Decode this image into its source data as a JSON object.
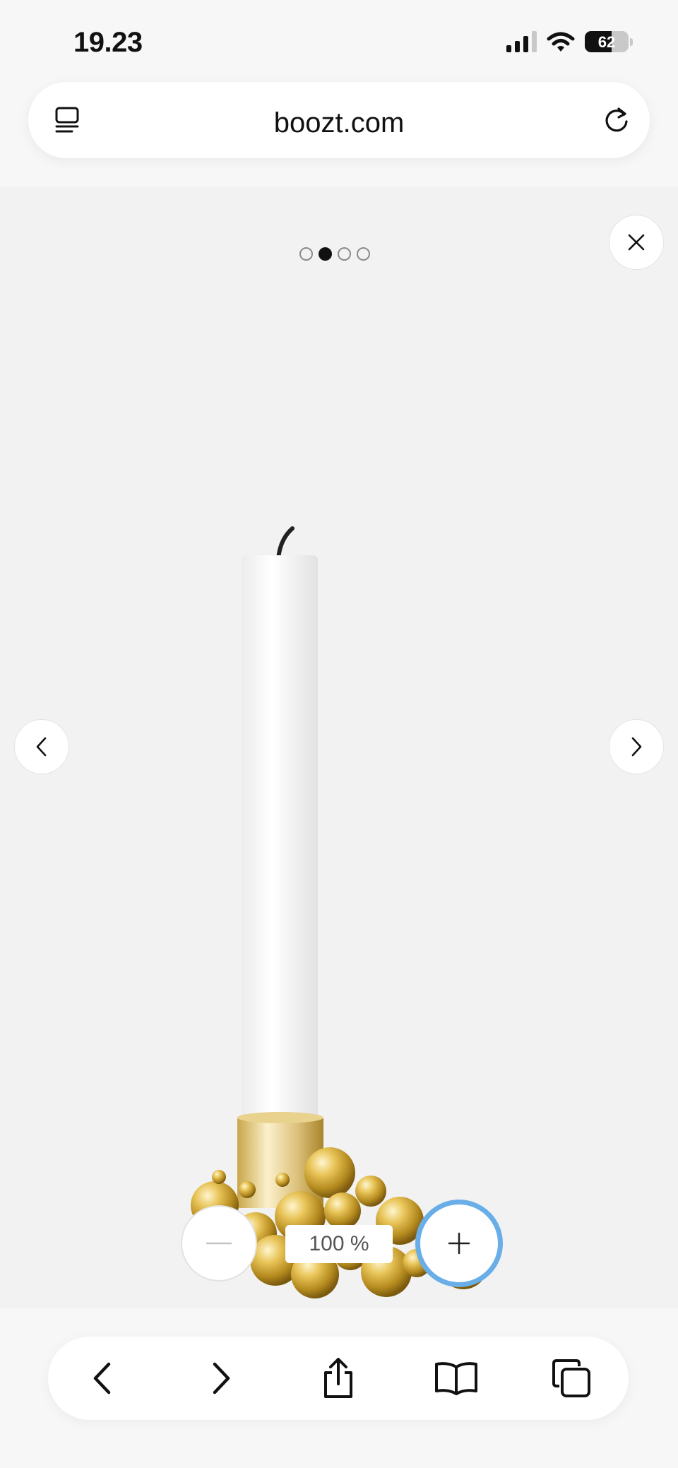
{
  "status_bar": {
    "time": "19.23",
    "battery_level": "62",
    "battery_fraction": 0.62,
    "icons": [
      "cellular-signal-icon",
      "wifi-icon",
      "battery-icon"
    ]
  },
  "address_bar": {
    "url": "boozt.com",
    "icons": [
      "reader-icon",
      "reload-icon"
    ]
  },
  "gallery": {
    "image_count": 4,
    "active_index": 1,
    "icons": [
      "close-icon",
      "chevron-left-icon",
      "chevron-right-icon"
    ]
  },
  "zoom": {
    "value": "100 %",
    "icons": [
      "minus-icon",
      "plus-icon"
    ]
  },
  "toolbar": {
    "icons": [
      "back-icon",
      "forward-icon",
      "share-icon",
      "bookmarks-icon",
      "tabs-icon"
    ]
  },
  "colors": {
    "focus_ring": "#6aaee8",
    "candle_gold": "#d4ad3a",
    "viewer_bg": "#f2f2f2"
  }
}
